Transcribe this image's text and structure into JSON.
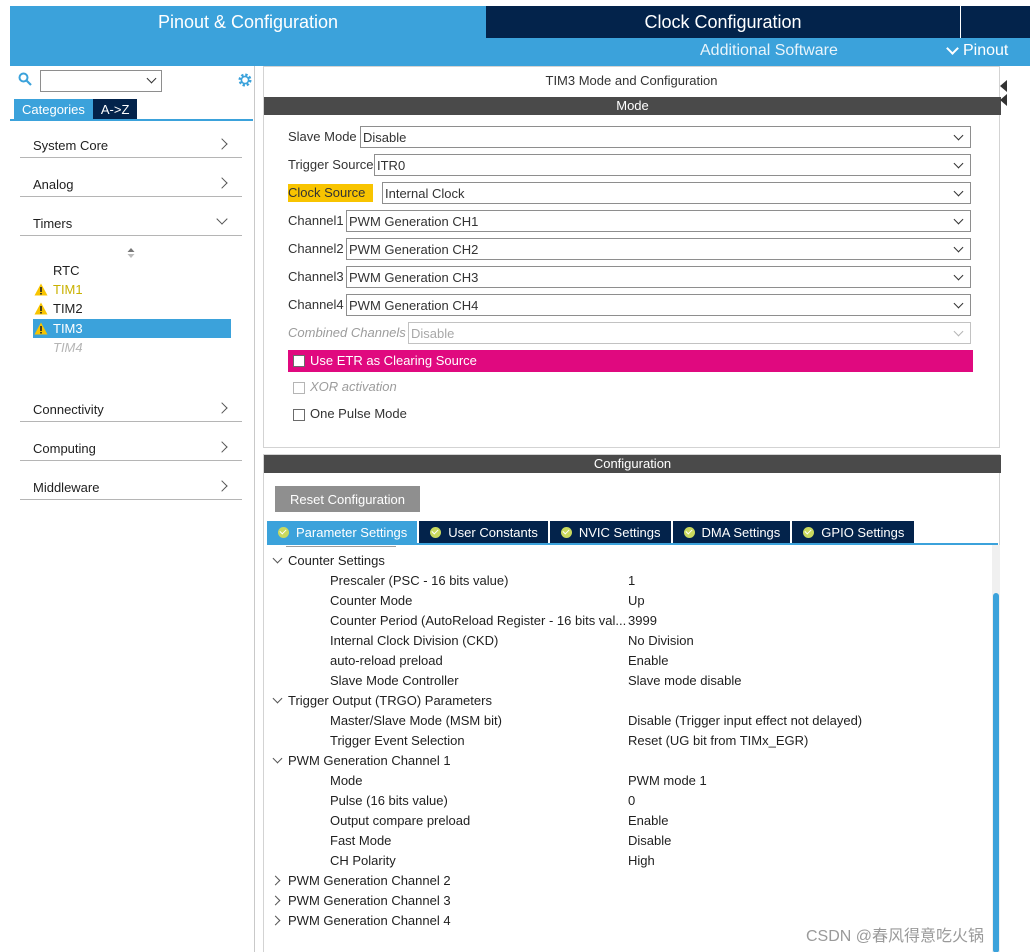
{
  "top_tabs": {
    "pinout": "Pinout & Configuration",
    "clock": "Clock Configuration"
  },
  "sub_bar": {
    "additional": "Additional Software",
    "pinout": "Pinout"
  },
  "left": {
    "search_value": "",
    "tabs": {
      "categories": "Categories",
      "az": "A->Z"
    },
    "categories": [
      "System Core",
      "Analog",
      "Timers"
    ],
    "timers": [
      "RTC",
      "TIM1",
      "TIM2",
      "TIM3",
      "TIM4"
    ],
    "categories_bottom": [
      "Connectivity",
      "Computing",
      "Middleware"
    ]
  },
  "mode": {
    "title": "TIM3 Mode and Configuration",
    "header": "Mode",
    "slave_mode": {
      "label": "Slave Mode",
      "value": "Disable"
    },
    "trigger_source": {
      "label": "Trigger Source",
      "value": "ITR0"
    },
    "clock_source": {
      "label": "Clock Source",
      "value": "Internal Clock"
    },
    "channel1": {
      "label": "Channel1",
      "value": "PWM Generation CH1"
    },
    "channel2": {
      "label": "Channel2",
      "value": "PWM Generation CH2"
    },
    "channel3": {
      "label": "Channel3",
      "value": "PWM Generation CH3"
    },
    "channel4": {
      "label": "Channel4",
      "value": "PWM Generation CH4"
    },
    "combined": {
      "label": "Combined Channels",
      "value": "Disable"
    },
    "etr": "Use ETR as Clearing Source",
    "xor": "XOR activation",
    "one_pulse": "One Pulse Mode"
  },
  "config": {
    "header": "Configuration",
    "reset_button": "Reset Configuration",
    "tabs": [
      "Parameter Settings",
      "User Constants",
      "NVIC Settings",
      "DMA Settings",
      "GPIO Settings"
    ],
    "groups": {
      "counter": "Counter Settings",
      "trgo": "Trigger Output (TRGO) Parameters",
      "pwm1": "PWM Generation Channel 1",
      "pwm2": "PWM Generation Channel 2",
      "pwm3": "PWM Generation Channel 3",
      "pwm4": "PWM Generation Channel 4"
    },
    "params": [
      {
        "name": "Prescaler (PSC - 16 bits value)",
        "value": "1"
      },
      {
        "name": "Counter Mode",
        "value": "Up"
      },
      {
        "name": "Counter Period (AutoReload Register - 16 bits val...",
        "value": "3999"
      },
      {
        "name": "Internal Clock Division (CKD)",
        "value": "No Division"
      },
      {
        "name": "auto-reload preload",
        "value": "Enable"
      },
      {
        "name": "Slave Mode Controller",
        "value": "Slave mode disable"
      },
      {
        "name": "Master/Slave Mode (MSM bit)",
        "value": "Disable (Trigger input effect not delayed)"
      },
      {
        "name": "Trigger Event Selection",
        "value": "Reset (UG bit from TIMx_EGR)"
      },
      {
        "name": "Mode",
        "value": "PWM mode 1"
      },
      {
        "name": "Pulse (16 bits value)",
        "value": "0"
      },
      {
        "name": "Output compare preload",
        "value": "Enable"
      },
      {
        "name": "Fast Mode",
        "value": "Disable"
      },
      {
        "name": "CH Polarity",
        "value": "High"
      }
    ]
  },
  "watermark": "CSDN @春风得意吃火锅",
  "colors": {
    "accent_blue": "#3ba2db",
    "navy": "#03234b",
    "etr_magenta": "#e0097f",
    "clock_source_highlight": "#f8c400",
    "warning_yellow": "#f8c400"
  }
}
